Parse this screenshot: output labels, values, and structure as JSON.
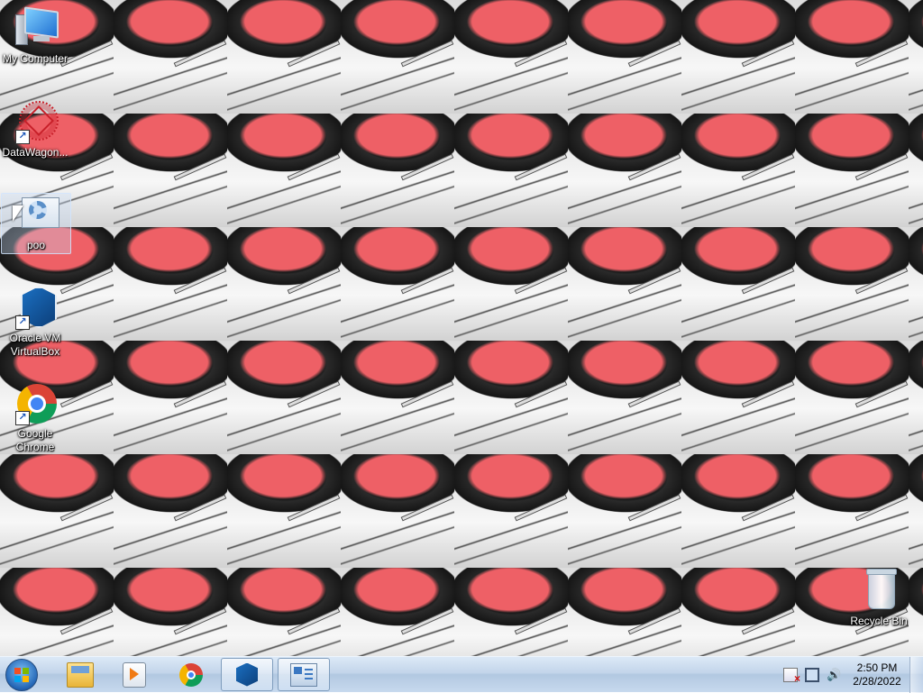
{
  "desktop": {
    "icons": [
      {
        "label": "My Computer",
        "icon": "computer-icon"
      },
      {
        "label": "DataWagon...",
        "icon": "datawagon-icon"
      },
      {
        "label": "poo",
        "icon": "poo-app-icon"
      },
      {
        "label": "Oracle VM VirtualBox",
        "icon": "virtualbox-icon"
      },
      {
        "label": "Google Chrome",
        "icon": "chrome-icon"
      },
      {
        "label": "Recycle Bin",
        "icon": "recycle-bin-icon"
      }
    ]
  },
  "taskbar": {
    "pinned": [
      {
        "icon": "start-orb-icon"
      },
      {
        "icon": "windows-explorer-icon"
      },
      {
        "icon": "windows-media-player-icon"
      },
      {
        "icon": "chrome-icon"
      },
      {
        "icon": "virtualbox-icon"
      },
      {
        "icon": "poo-app-icon"
      }
    ],
    "tray": {
      "icons": [
        "action-center-flag-icon",
        "network-icon",
        "volume-icon"
      ],
      "time": "2:50 PM",
      "date": "2/28/2022"
    }
  }
}
